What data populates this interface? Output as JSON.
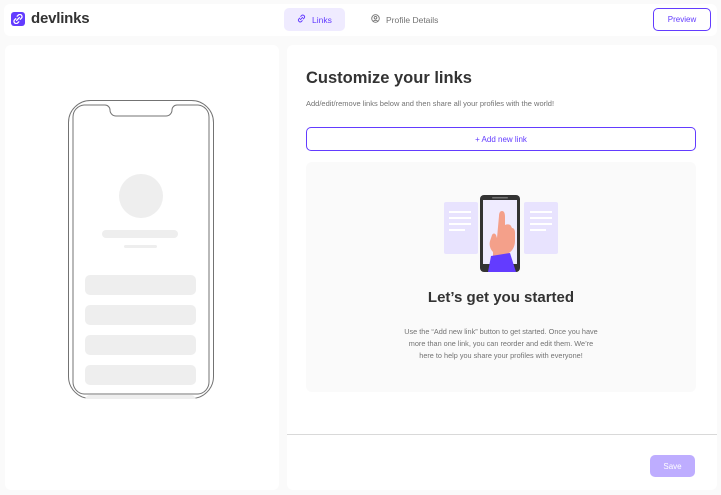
{
  "header": {
    "logo_text": "devlinks",
    "tabs": [
      {
        "label": "Links",
        "icon": "link-icon",
        "active": true
      },
      {
        "label": "Profile Details",
        "icon": "user-circle-icon",
        "active": false
      }
    ],
    "preview_label": "Preview"
  },
  "editor": {
    "title": "Customize your links",
    "subtitle": "Add/edit/remove links below and then share all your profiles with the world!",
    "add_link_label": "+ Add new link",
    "empty_state": {
      "illustration": "phone-hand-illustration",
      "title": "Let’s get you started",
      "description": "Use the “Add new link” button to get started. Once you have more than one link, you can reorder and edit them. We’re here to help you share your profiles with everyone!"
    },
    "save_label": "Save"
  },
  "colors": {
    "accent": "#633cff",
    "accent_light": "#efebff",
    "accent_disabled": "#beadff",
    "placeholder": "#eeeeee"
  }
}
